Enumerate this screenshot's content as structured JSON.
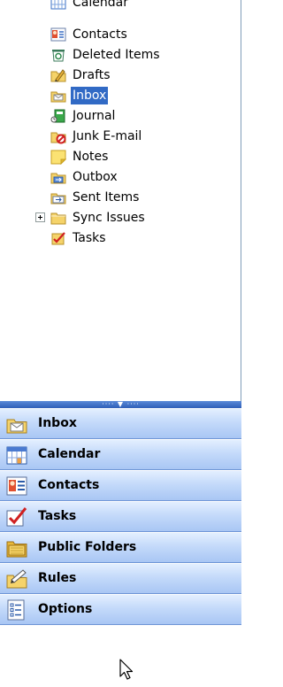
{
  "folder_tree": {
    "items": [
      {
        "label": "Calendar",
        "icon": "calendar-icon"
      },
      {
        "label": "Contacts",
        "icon": "contacts-icon"
      },
      {
        "label": "Deleted Items",
        "icon": "trash-icon"
      },
      {
        "label": "Drafts",
        "icon": "drafts-icon"
      },
      {
        "label": "Inbox",
        "icon": "inbox-icon",
        "selected": true
      },
      {
        "label": "Journal",
        "icon": "journal-icon"
      },
      {
        "label": "Junk E-mail",
        "icon": "junk-mail-icon"
      },
      {
        "label": "Notes",
        "icon": "notes-icon"
      },
      {
        "label": "Outbox",
        "icon": "outbox-icon"
      },
      {
        "label": "Sent Items",
        "icon": "sent-items-icon"
      },
      {
        "label": "Sync Issues",
        "icon": "folder-icon",
        "expandable": true
      },
      {
        "label": "Tasks",
        "icon": "tasks-icon"
      }
    ]
  },
  "navigation": {
    "buttons": [
      {
        "label": "Inbox",
        "icon": "inbox-icon"
      },
      {
        "label": "Calendar",
        "icon": "calendar-icon"
      },
      {
        "label": "Contacts",
        "icon": "contacts-icon"
      },
      {
        "label": "Tasks",
        "icon": "tasks-icon"
      },
      {
        "label": "Public Folders",
        "icon": "public-folders-icon"
      },
      {
        "label": "Rules",
        "icon": "rules-icon"
      },
      {
        "label": "Options",
        "icon": "options-icon"
      }
    ]
  },
  "colors": {
    "selection": "#316ac5",
    "nav_button_top": "#e3efff",
    "nav_button_bottom": "#a9c6f4",
    "splitter": "#2f5fb8"
  }
}
